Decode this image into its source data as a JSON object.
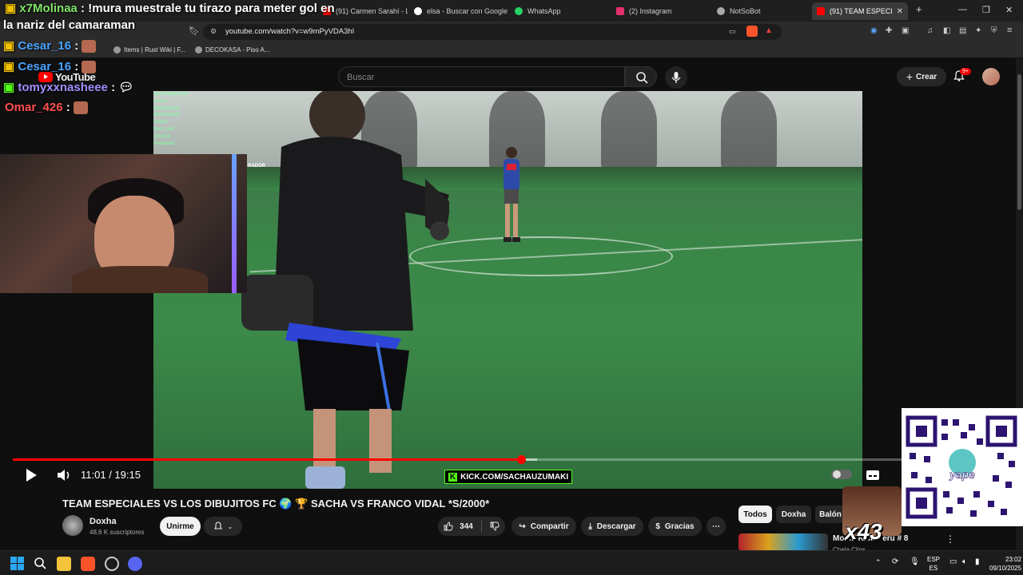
{
  "browser": {
    "tabs": [
      {
        "label": "(91) Carmen Sarahí - L",
        "color": "#ff0000"
      },
      {
        "label": "elsa - Buscar con Google",
        "color": "#4285f4"
      },
      {
        "label": "WhatsApp",
        "color": "#25d366"
      },
      {
        "label": "(2) Instagram",
        "color": "#e1306c"
      },
      {
        "label": "NotSoBot",
        "color": "#aaaaaa"
      },
      {
        "label": "(91) TEAM ESPECIALE",
        "color": "#ff0000"
      }
    ],
    "url": "youtube.com/watch?v=w9mPyVDA3hI",
    "bookmarks": [
      {
        "label": "Items | Rust Wiki | F..."
      },
      {
        "label": "DECOKASA - Piso A..."
      }
    ]
  },
  "youtube": {
    "logo": "YouTube",
    "search_placeholder": "Buscar",
    "create_label": "Crear",
    "notification_count": "9+"
  },
  "overlay_chat": [
    {
      "user": "x7Molinaa",
      "sep": " : ",
      "text": "!mura muestrale tu tirazo para meter gol en",
      "color": "#7fe36a"
    },
    {
      "user": "",
      "sep": "",
      "text": "la nariz del camaraman",
      "color": "#ffffff"
    },
    {
      "user": "Cesar_16",
      "sep": " : ",
      "text": "",
      "color": "#4aa3ff"
    },
    {
      "user": "Cesar_16",
      "sep": " : ",
      "text": "",
      "color": "#4aa3ff"
    },
    {
      "user": "tomyxxnasheee",
      "sep": " : ",
      "text": "",
      "color": "#a58cff"
    },
    {
      "user": "Omar_426",
      "sep": " : ",
      "text": "",
      "color": "#ff4f4f"
    }
  ],
  "mini_chat": [
    "sperindetemuxd:",
    "cnrtuu:",
    "atustinaowo:",
    "elnishoxd20:",
    "ovitctc:",
    "hans_xdd",
    "1loveu2:",
    "freanquito:"
  ],
  "video_overlay": {
    "corner_label": "RADOR",
    "kick_banner": "KICK.COM/SACHAUZUMAKI",
    "kick_letter": "K"
  },
  "player": {
    "time_current": "11:01",
    "time_separator": " / ",
    "time_total": "19:15",
    "progress_fraction": 0.572,
    "buffered_fraction": 0.59
  },
  "video": {
    "title": "TEAM ESPECIALES VS LOS DIBUJITOS FC 🌍 🏆 SACHA VS FRANCO VIDAL *S/2000*",
    "channel": "Doxha",
    "subscribers": "48,6 K suscriptores",
    "subscribe_label": "Unirme",
    "likes": "344",
    "share_label": "Compartir",
    "download_label": "Descargar",
    "thanks_label": "Gracias"
  },
  "chips": [
    "Todos",
    "Doxha",
    "Balón"
  ],
  "recommendation": {
    "title": "Mon... Kick Perú # 8",
    "channel": "Chela Clips"
  },
  "stream_overlay": {
    "multiplier": "x43",
    "qr_brand": "yape"
  },
  "taskbar": {
    "lang_top": "ESP",
    "lang_bottom": "ES",
    "time": "23:02",
    "date": "09/10/2025"
  },
  "colors": {
    "accent": "#ff0000",
    "background": "#0f0f0f",
    "kick_green": "#53fc18"
  }
}
